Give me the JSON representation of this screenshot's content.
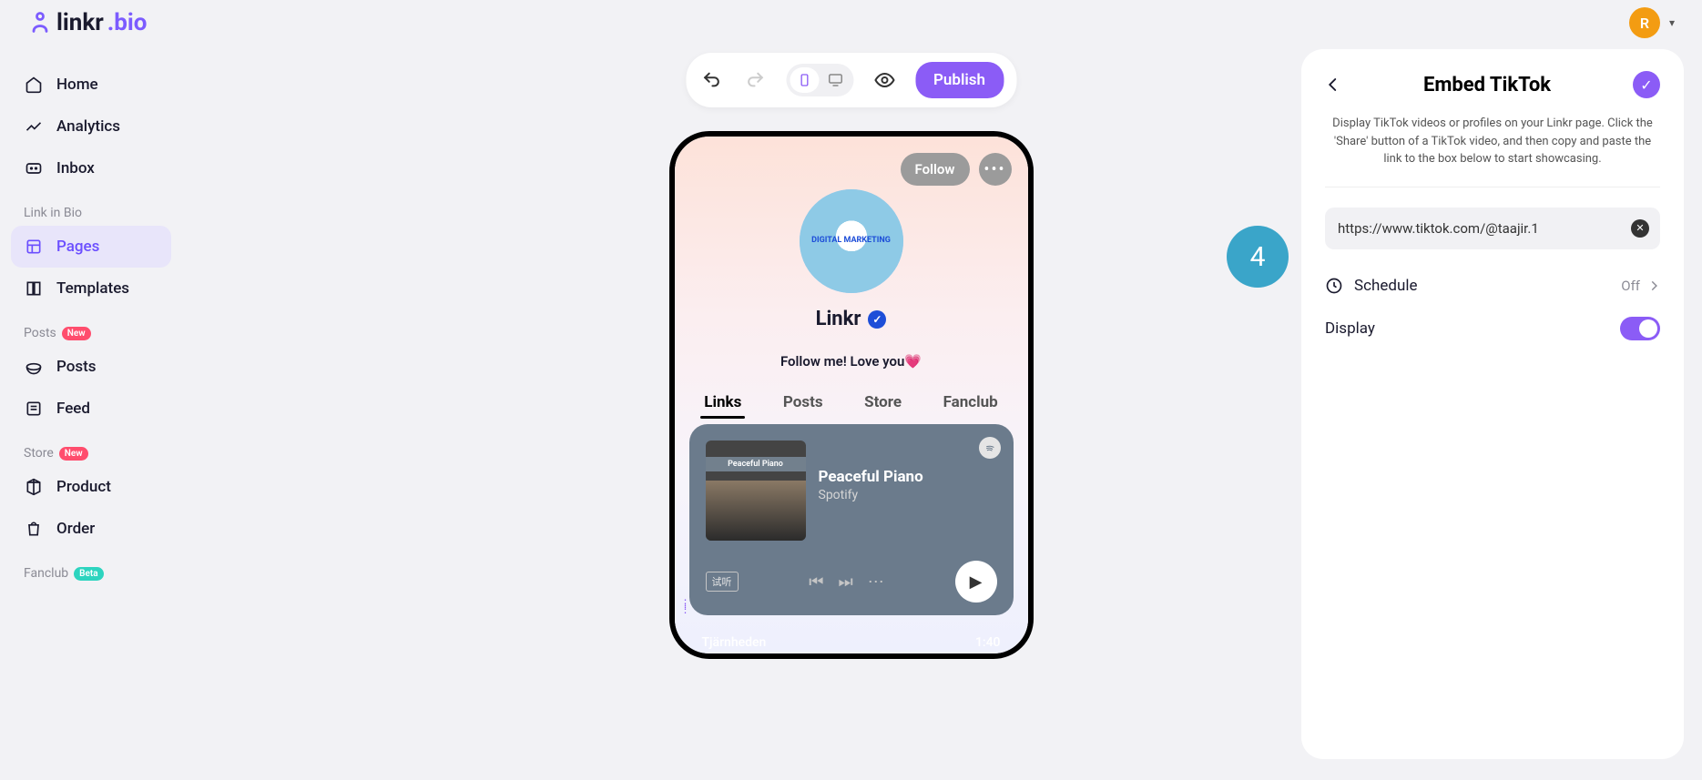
{
  "brand": {
    "name_a": "linkr",
    "name_b": ".bio"
  },
  "user": {
    "initial": "R"
  },
  "nav": {
    "home": "Home",
    "analytics": "Analytics",
    "inbox": "Inbox",
    "section_linkinbio": "Link in Bio",
    "pages": "Pages",
    "templates": "Templates",
    "section_posts": "Posts",
    "posts": "Posts",
    "feed": "Feed",
    "section_store": "Store",
    "product": "Product",
    "order": "Order",
    "section_fanclub": "Fanclub",
    "new_badge": "New",
    "beta_badge": "Beta"
  },
  "toolbar": {
    "publish": "Publish"
  },
  "phone": {
    "follow": "Follow",
    "name": "Linkr",
    "bio": "Follow me! Love you💗",
    "avatar_label": "DIGITAL MARKETING",
    "tabs": {
      "links": "Links",
      "posts": "Posts",
      "store": "Store",
      "fanclub": "Fanclub"
    },
    "spotify": {
      "art_label": "Peaceful Piano",
      "title": "Peaceful Piano",
      "subtitle": "Spotify",
      "small": "试听"
    },
    "track": {
      "name": "Tjärnheden",
      "time": "1:40"
    }
  },
  "panel": {
    "title": "Embed TikTok",
    "desc": "Display TikTok videos or profiles on your Linkr page. Click the 'Share' button of a TikTok video, and then copy and paste the link to the box below to start showcasing.",
    "url": "https://www.tiktok.com/@taajir.1",
    "schedule_label": "Schedule",
    "schedule_value": "Off",
    "display_label": "Display"
  },
  "step": "4"
}
